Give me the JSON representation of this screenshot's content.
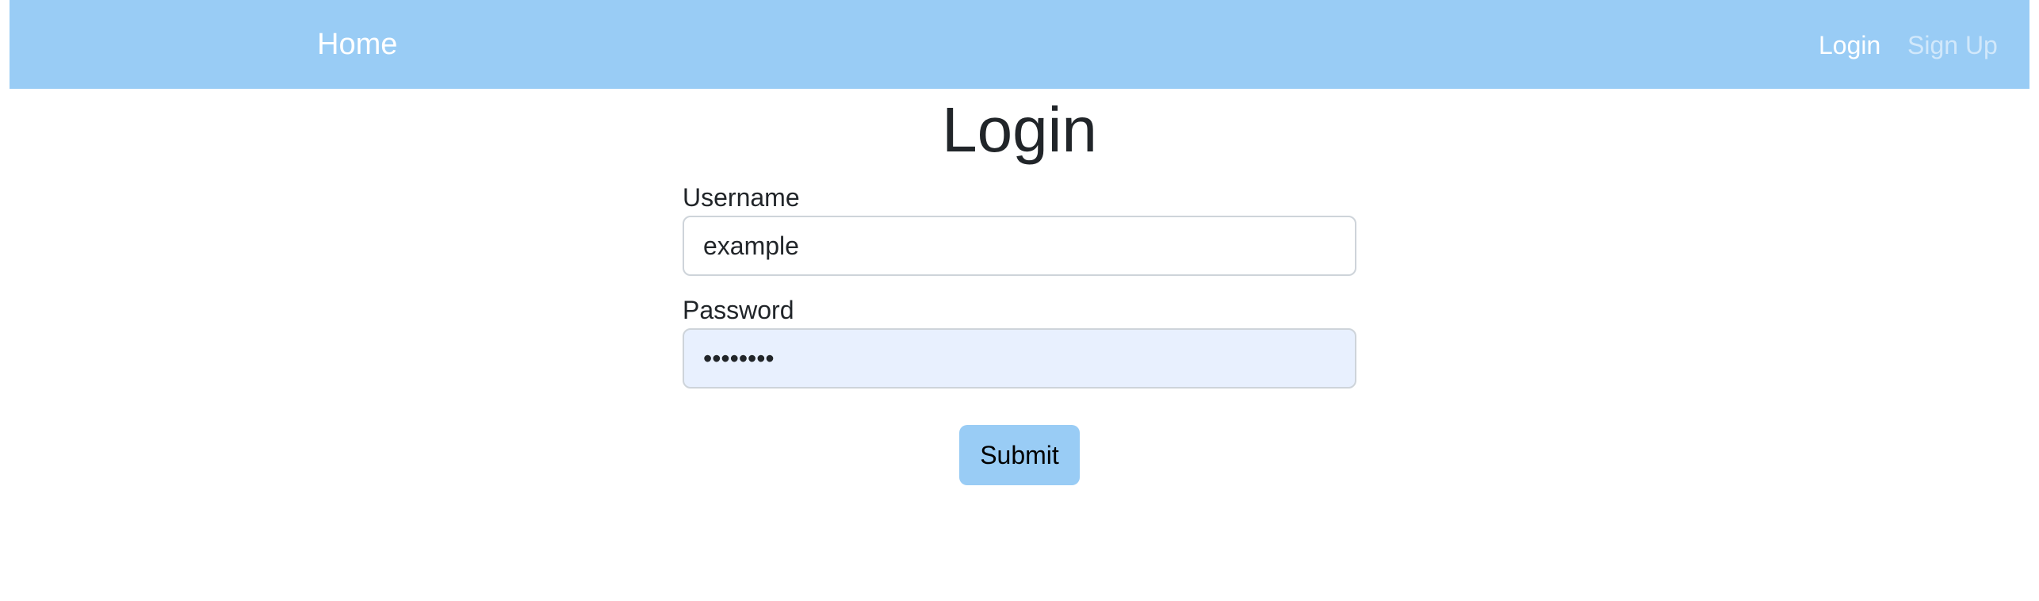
{
  "navbar": {
    "home_label": "Home",
    "login_label": "Login",
    "signup_label": "Sign Up",
    "background_color": "#99ccf5"
  },
  "main": {
    "title": "Login",
    "form": {
      "username": {
        "label": "Username",
        "value": "example"
      },
      "password": {
        "label": "Password",
        "value": "password"
      },
      "submit_label": "Submit"
    }
  },
  "colors": {
    "accent": "#99ccf5",
    "autofill_background": "#e8f0fe",
    "text": "#212529"
  }
}
